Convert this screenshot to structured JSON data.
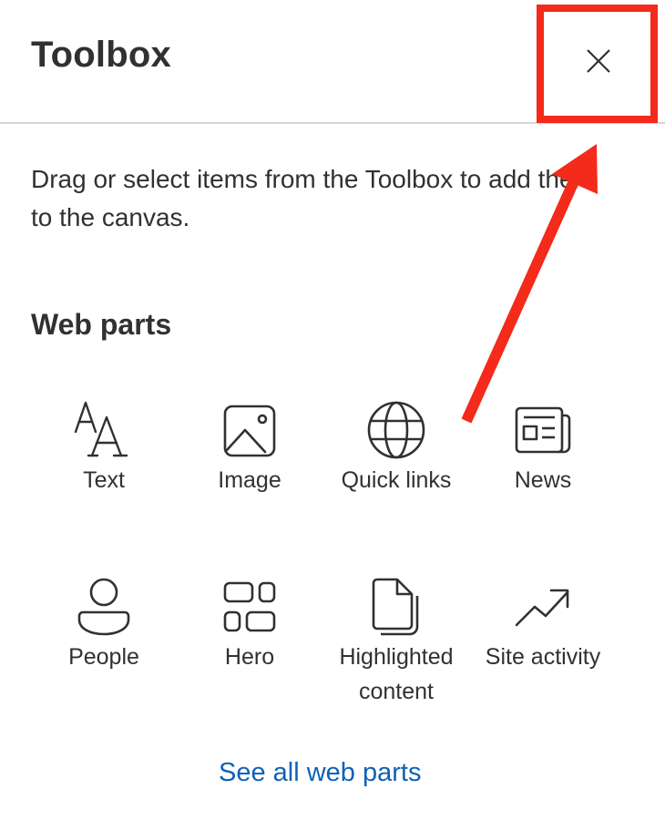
{
  "toolbox": {
    "title": "Toolbox",
    "close_icon": "close-icon",
    "description": "Drag or select items from the Toolbox to add them to the canvas.",
    "section_title": "Web parts",
    "web_parts": [
      {
        "label": "Text",
        "icon": "text-icon"
      },
      {
        "label": "Image",
        "icon": "image-icon"
      },
      {
        "label": "Quick links",
        "icon": "globe-icon"
      },
      {
        "label": "News",
        "icon": "newspaper-icon"
      },
      {
        "label": "People",
        "icon": "person-icon"
      },
      {
        "label": "Hero",
        "icon": "grid-icon"
      },
      {
        "label": "Highlighted content",
        "icon": "documents-icon"
      },
      {
        "label": "Site activity",
        "icon": "trending-icon"
      }
    ],
    "see_all_label": "See all web parts"
  },
  "annotation": {
    "color": "#f42a1a"
  }
}
